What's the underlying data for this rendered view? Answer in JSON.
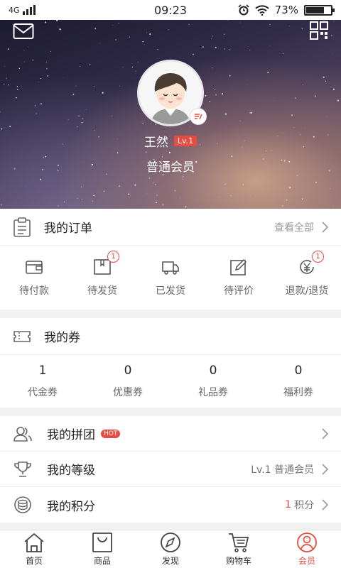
{
  "status_bar": {
    "network": "4G",
    "time": "09:23",
    "battery": "73%",
    "battery_level": 0.73
  },
  "header": {
    "icons": [
      "mail-icon",
      "qr-code-icon"
    ]
  },
  "profile": {
    "name": "王然",
    "level": "Lv.1",
    "member_type": "普通会员"
  },
  "orders": {
    "title": "我的订单",
    "view_all": "查看全部",
    "items": [
      {
        "label": "待付款",
        "icon": "wallet-icon",
        "badge": ""
      },
      {
        "label": "待发货",
        "icon": "package-icon",
        "badge": "1"
      },
      {
        "label": "已发货",
        "icon": "truck-icon",
        "badge": ""
      },
      {
        "label": "待评价",
        "icon": "edit-icon",
        "badge": ""
      },
      {
        "label": "退款/退货",
        "icon": "refund-icon",
        "badge": "1"
      }
    ]
  },
  "coupons": {
    "title": "我的券",
    "items": [
      {
        "count": "1",
        "label": "代金券"
      },
      {
        "count": "0",
        "label": "优惠券"
      },
      {
        "count": "0",
        "label": "礼品券"
      },
      {
        "count": "0",
        "label": "福利券"
      }
    ]
  },
  "menu": {
    "group_buy": {
      "title": "我的拼团",
      "badge": "HOT"
    },
    "level": {
      "title": "我的等级",
      "value": "Lv.1 普通会员"
    },
    "points": {
      "title": "我的积分",
      "value": "1",
      "unit": "积分"
    }
  },
  "tabbar": {
    "items": [
      {
        "label": "首页",
        "icon": "home-icon"
      },
      {
        "label": "商品",
        "icon": "shopping-bag-icon"
      },
      {
        "label": "发现",
        "icon": "compass-icon"
      },
      {
        "label": "购物车",
        "icon": "cart-icon"
      },
      {
        "label": "会员",
        "icon": "member-icon",
        "active": true
      }
    ]
  },
  "colors": {
    "accent": "#e54d42"
  }
}
